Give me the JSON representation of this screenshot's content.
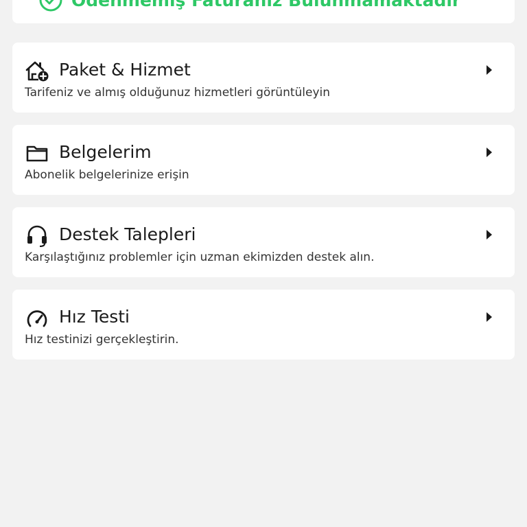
{
  "status": {
    "message": "Ödenmemiş Faturanız Bulunmamaktadır",
    "icon": "check-circle-icon",
    "color": "#2ec866"
  },
  "menu": {
    "items": [
      {
        "title": "Paket & Hizmet",
        "subtitle": "Tarifeniz ve almış olduğunuz hizmetleri görüntüleyin",
        "icon": "home-add-icon"
      },
      {
        "title": "Belgelerim",
        "subtitle": "Abonelik belgelerinize erişin",
        "icon": "folder-icon"
      },
      {
        "title": "Destek Talepleri",
        "subtitle": "Karşılaştığınız problemler için uzman ekimizden destek alın.",
        "icon": "headset-icon"
      },
      {
        "title": "Hız Testi",
        "subtitle": "Hız testinizi gerçekleştirin.",
        "icon": "speedometer-icon"
      }
    ]
  }
}
